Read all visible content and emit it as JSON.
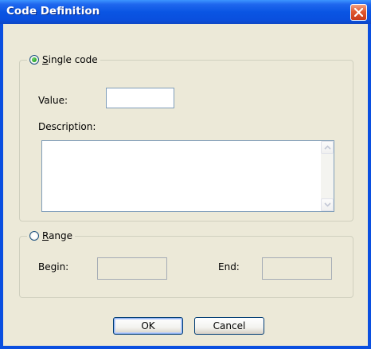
{
  "window": {
    "title": "Code Definition"
  },
  "single_code": {
    "label_mnemonic": "S",
    "label_rest": "ingle code",
    "selected": true,
    "value_label": "Value:",
    "value": "",
    "description_label": "Description:",
    "description": ""
  },
  "range": {
    "label_mnemonic": "R",
    "label_rest": "ange",
    "selected": false,
    "begin_label": "Begin:",
    "begin_value": "",
    "end_label": "End:",
    "end_value": ""
  },
  "buttons": {
    "ok": "OK",
    "cancel": "Cancel"
  },
  "colors": {
    "titlebar": "#0a55e3",
    "dialog_bg": "#ece9d8",
    "close_button": "#e0582f",
    "field_border": "#7f9db9"
  }
}
